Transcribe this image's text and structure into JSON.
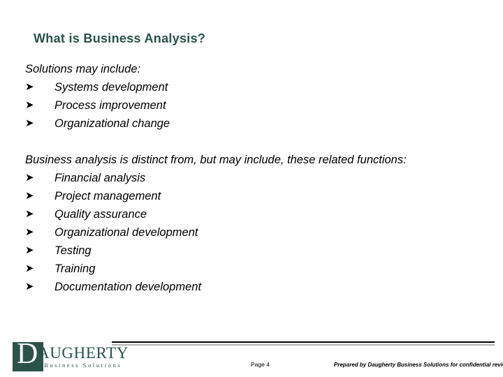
{
  "slide": {
    "title": "What is Business Analysis?",
    "blocks": [
      {
        "lead": "Solutions may include:",
        "bullet_glyph": "➤",
        "items": [
          "Systems development",
          "Process improvement",
          "Organizational change"
        ]
      },
      {
        "lead": "Business analysis is distinct from, but may include, these related functions:",
        "bullet_glyph": "➤",
        "items": [
          "Financial analysis",
          "Project management",
          "Quality assurance",
          "Organizational development",
          "Testing",
          "Training",
          "Documentation development"
        ]
      }
    ]
  },
  "logo": {
    "monogram": "D",
    "word": "AUGHERTY",
    "tagline": "Business Solutions",
    "color": "#2a5249"
  },
  "footer": {
    "page_label": "Page 4",
    "confidential": "Prepared by Daugherty Business Solutions for confidential review"
  },
  "colors": {
    "title": "#2a5249",
    "brand": "#2a5249",
    "rule": "#000000",
    "rule_shadow": "#b3b3b3",
    "background": "#ffffff",
    "text": "#000000"
  }
}
